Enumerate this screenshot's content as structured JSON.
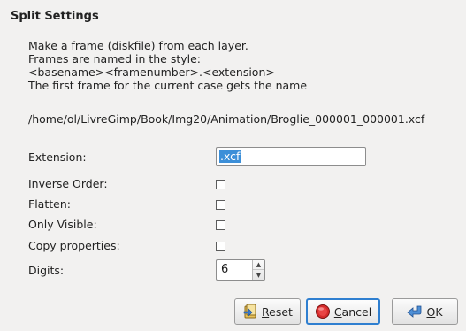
{
  "dialog": {
    "title": "Split Settings",
    "description": [
      "Make a frame (diskfile) from each layer.",
      "Frames are named in the style:",
      "<basename><framenumber>.<extension>",
      "The first frame for the current case gets the name"
    ],
    "path": "/home/ol/LivreGimp/Book/Img20/Animation/Broglie_000001_000001.xcf"
  },
  "fields": {
    "extension_label": "Extension:",
    "extension_value": ".xcf",
    "inverse_order_label": "Inverse Order:",
    "inverse_order_checked": false,
    "flatten_label": "Flatten:",
    "flatten_checked": false,
    "only_visible_label": "Only Visible:",
    "only_visible_checked": false,
    "copy_properties_label": "Copy properties:",
    "copy_properties_checked": false,
    "digits_label": "Digits:",
    "digits_value": "6"
  },
  "buttons": {
    "reset_mnemonic": "R",
    "reset_rest": "eset",
    "cancel_mnemonic": "C",
    "cancel_rest": "ancel",
    "ok_mnemonic": "O",
    "ok_rest": "K",
    "focused": "cancel"
  },
  "icons": {
    "reset": "reset-icon",
    "cancel": "cancel-icon",
    "ok": "ok-icon"
  },
  "colors": {
    "dialog_bg": "#f2f1f0",
    "selection": "#3c8fd8",
    "focus_ring": "#2f7fd0"
  }
}
